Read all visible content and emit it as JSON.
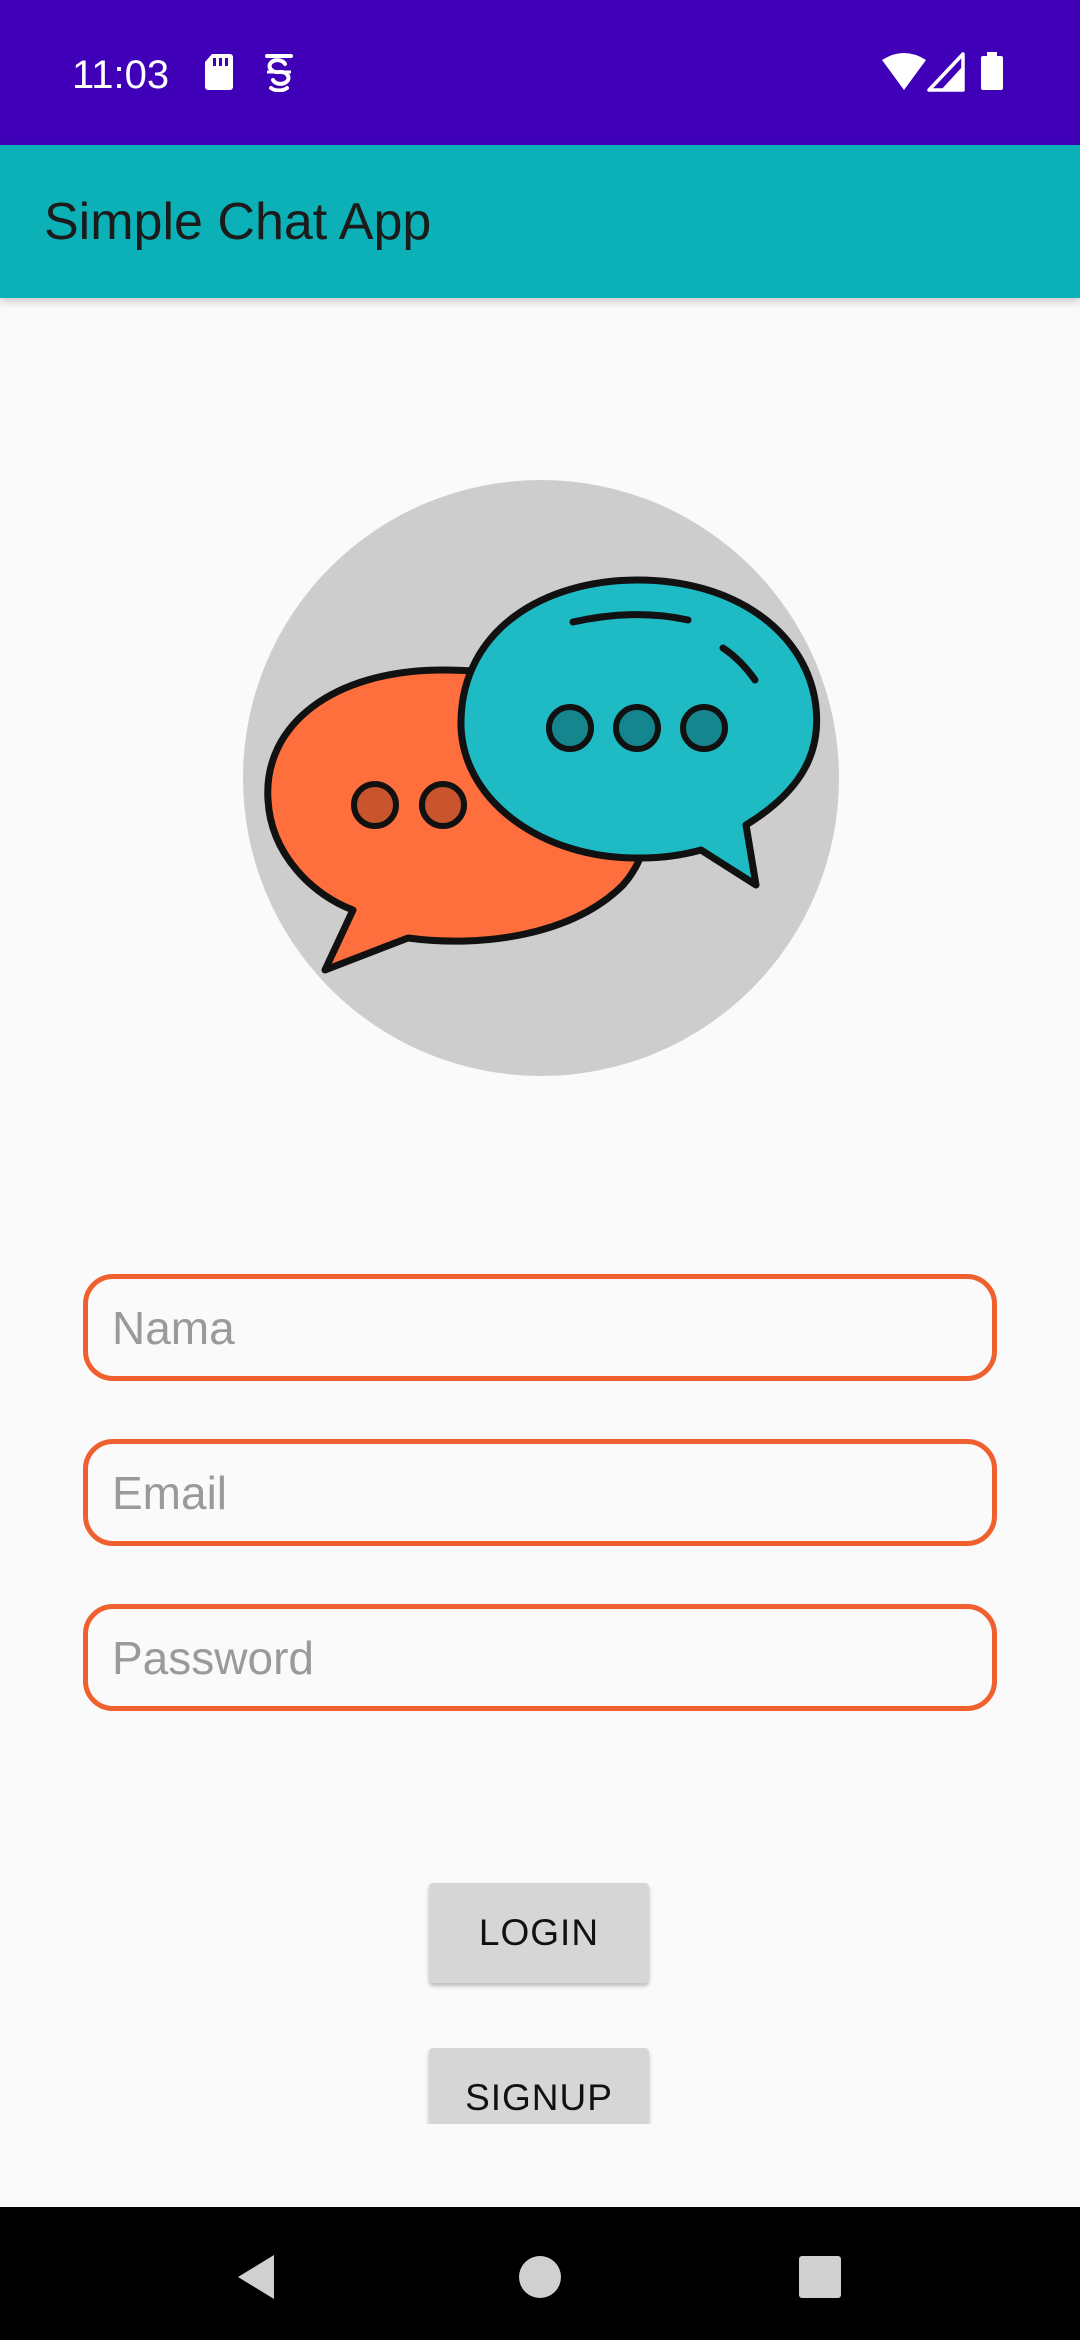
{
  "status_bar": {
    "time": "11:03",
    "background": "#3f00b8",
    "left_icons": [
      "sd-card-icon",
      "accessibility-icon"
    ],
    "right_icons": [
      "wifi-icon",
      "cell-signal-icon",
      "battery-icon"
    ]
  },
  "app_bar": {
    "title": "Simple Chat App",
    "background": "#0bb1b6"
  },
  "logo": {
    "icon": "chat-bubbles-icon"
  },
  "form": {
    "name_placeholder": "Nama",
    "email_placeholder": "Email",
    "password_placeholder": "Password",
    "border_color": "#f0602f"
  },
  "buttons": {
    "login_label": "LOGIN",
    "signup_label": "SIGNUP"
  },
  "nav_bar": {
    "icons": [
      "back-icon",
      "home-icon",
      "recents-icon"
    ]
  }
}
